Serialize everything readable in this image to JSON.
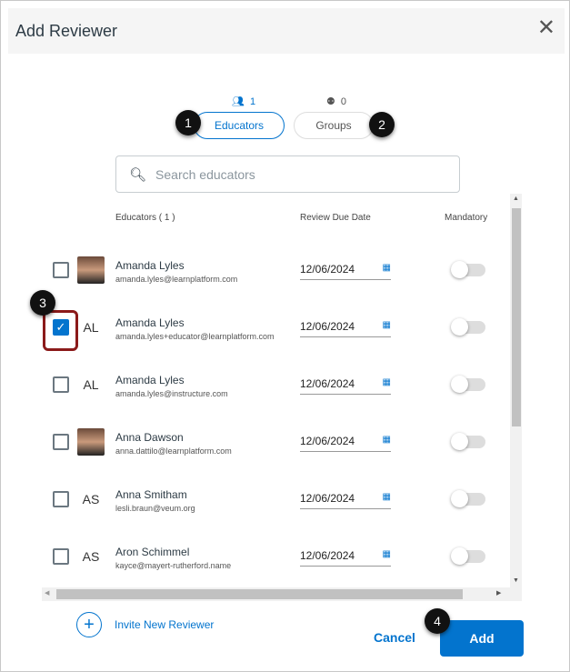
{
  "dialog": {
    "title": "Add Reviewer",
    "close_icon": "close-icon"
  },
  "tabs": [
    {
      "label": "Educators",
      "count": "1",
      "icon": "people-icon"
    },
    {
      "label": "Groups",
      "count": "0",
      "icon": "group-icon"
    }
  ],
  "search": {
    "placeholder": "Search educators"
  },
  "columns": {
    "educators": "Educators ( 1 )",
    "due": "Review Due Date",
    "mandatory": "Mandatory"
  },
  "rows": [
    {
      "name": "Amanda Lyles",
      "email": "amanda.lyles@learnplatform.com",
      "initials": "",
      "photo": true,
      "checked": false,
      "date": "12/06/2024",
      "mandatory": false
    },
    {
      "name": "Amanda Lyles",
      "email": "amanda.lyles+educator@learnplatform.com",
      "initials": "AL",
      "photo": false,
      "checked": true,
      "date": "12/06/2024",
      "mandatory": false
    },
    {
      "name": "Amanda Lyles",
      "email": "amanda.lyles@instructure.com",
      "initials": "AL",
      "photo": false,
      "checked": false,
      "date": "12/06/2024",
      "mandatory": false
    },
    {
      "name": "Anna Dawson",
      "email": "anna.dattilo@learnplatform.com",
      "initials": "",
      "photo": true,
      "checked": false,
      "date": "12/06/2024",
      "mandatory": false
    },
    {
      "name": "Anna Smitham",
      "email": "lesli.braun@veum.org",
      "initials": "AS",
      "photo": false,
      "checked": false,
      "date": "12/06/2024",
      "mandatory": false
    },
    {
      "name": "Aron Schimmel",
      "email": "kayce@mayert-rutherford.name",
      "initials": "AS",
      "photo": false,
      "checked": false,
      "date": "12/06/2024",
      "mandatory": false
    }
  ],
  "footer": {
    "invite": "Invite New Reviewer",
    "cancel": "Cancel",
    "add": "Add"
  },
  "callouts": [
    "1",
    "2",
    "3",
    "4"
  ],
  "colors": {
    "accent": "#0374ce",
    "highlight": "#8b1a1a"
  }
}
